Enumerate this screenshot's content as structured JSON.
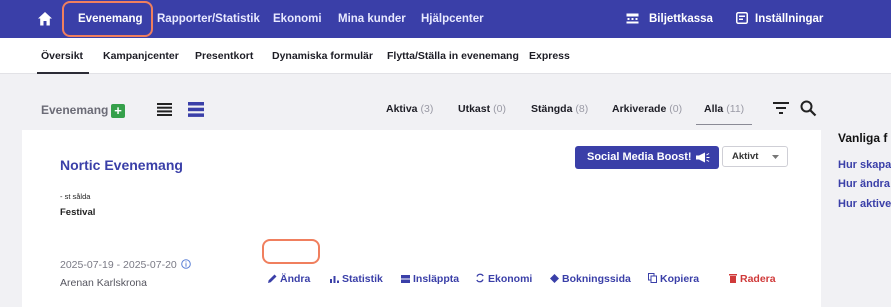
{
  "topnav": {
    "items": [
      "Evenemang",
      "Rapporter/Statistik",
      "Ekonomi",
      "Mina kunder",
      "Hjälpcenter"
    ],
    "right": [
      "Biljettkassa",
      "Inställningar"
    ]
  },
  "subnav": {
    "tabs": [
      "Översikt",
      "Kampanjcenter",
      "Presentkort",
      "Dynamiska formulär",
      "Flytta/Ställa in evenemang",
      "Express"
    ]
  },
  "filterbar": {
    "title": "Evenemang",
    "add_label": "+",
    "statuses": [
      {
        "label": "Aktiva",
        "count": "(3)"
      },
      {
        "label": "Utkast",
        "count": "(0)"
      },
      {
        "label": "Stängda",
        "count": "(8)"
      },
      {
        "label": "Arkiverade",
        "count": "(0)"
      },
      {
        "label": "Alla",
        "count": "(11)"
      }
    ]
  },
  "event": {
    "title": "Nortic Evenemang",
    "sold": "- st sålda",
    "category": "Festival",
    "boost_label": "Social Media Boost!",
    "status_value": "Aktivt",
    "dates": "2025-07-19 - 2025-07-20",
    "venue": "Arenan Karlskrona",
    "actions": [
      "Ändra",
      "Statistik",
      "Insläppta",
      "Ekonomi",
      "Bokningssida",
      "Kopiera",
      "Radera"
    ]
  },
  "faq": {
    "title": "Vanliga f",
    "links": [
      "Hur skapa",
      "Hur ändra",
      "Hur aktive"
    ]
  },
  "colors": {
    "brand": "#3a3fa8",
    "highlight": "#f07f5e",
    "add": "#35a04a",
    "danger": "#d03a3a"
  }
}
